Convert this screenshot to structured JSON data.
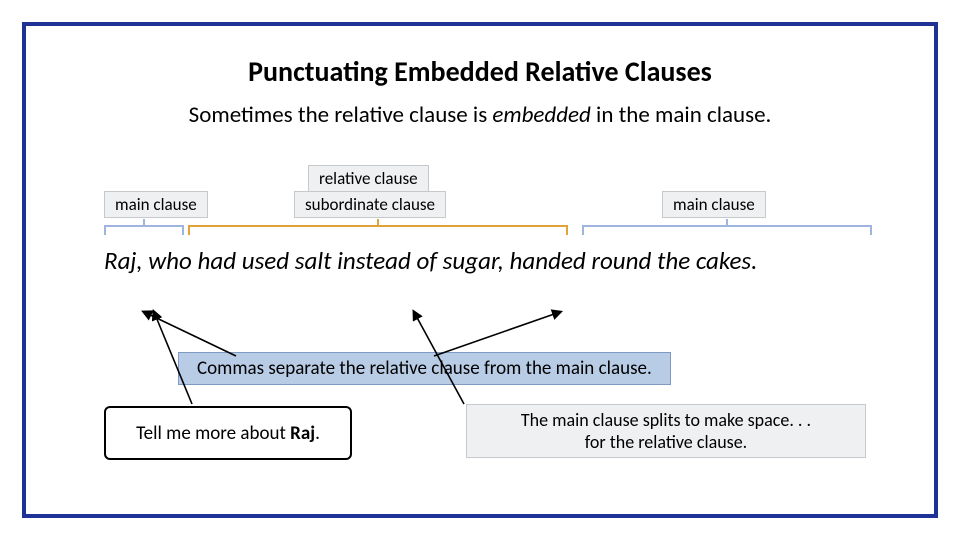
{
  "title": "Punctuating Embedded Relative Clauses",
  "intro": {
    "pre": "Sometimes the relative clause is ",
    "em": "embedded",
    "post": " in the main clause."
  },
  "labels": {
    "main_left": "main clause",
    "relative": "relative clause",
    "subordinate": "subordinate clause",
    "main_right": "main clause"
  },
  "sentence": {
    "part1": "Raj,",
    "part2": " who had used salt instead of sugar,",
    "part3": "  handed round the cakes."
  },
  "commas_note": "Commas separate the relative clause from the main clause.",
  "speech": {
    "pre": "Tell me more about ",
    "bold": "Raj",
    "post": "."
  },
  "split_note": {
    "line1": "The main clause splits to make space. . .",
    "line2": "for the relative clause."
  },
  "colors": {
    "frame": "#1f3296",
    "bracket_main": "#9eb6de",
    "bracket_sub": "#e2a23a",
    "commas_bg": "#b9cce5"
  }
}
